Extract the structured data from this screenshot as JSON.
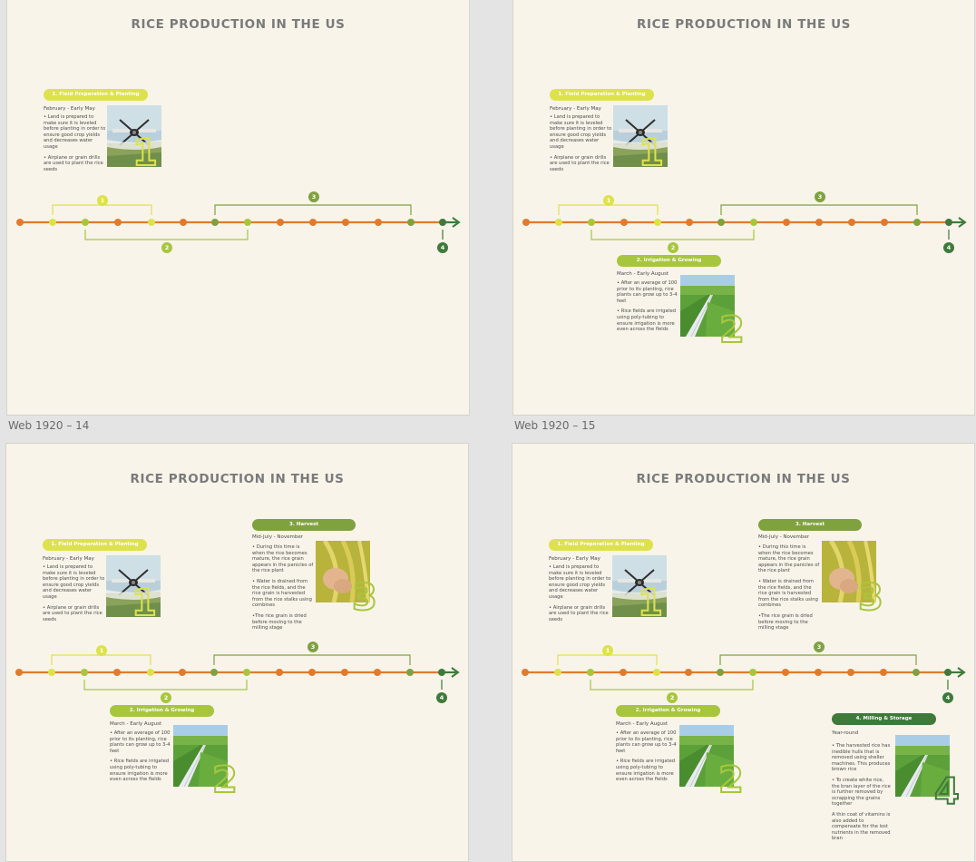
{
  "colors": {
    "orange": "#e07b2e",
    "yellow": "#dde24c",
    "lime": "#a7c63d",
    "olive": "#7fa23f",
    "darkgreen": "#3f7a3a",
    "background": "#f8f4ea"
  },
  "title": "RICE PRODUCTION IN THE US",
  "frame_labels": {
    "f14": "Web 1920 – 14",
    "f15": "Web 1920 – 15"
  },
  "markers": {
    "m1": "1",
    "m2": "2",
    "m3": "3",
    "m4": "4"
  },
  "steps": {
    "s1": {
      "label": "1. Field Preparation & Planting",
      "date": "February - Early May",
      "b1": "• Land is prepared to make sure it is leveled before planting in order to ensure good crop yields and decreases water usage",
      "b2": "• Airplane or grain drills are used to plant the rice seeds",
      "num": "1",
      "image_icon": "crop-duster-airplane-image"
    },
    "s2": {
      "label": "2. Irrigation & Growing",
      "date": "March - Early August",
      "b1": "• After an average of 100 prior to its planting, rice plants can grow up to 3-4 feet",
      "b2": "• Rice fields are irrigated using poly-tubing to ensure irrigation is more even across the fields",
      "num": "2",
      "image_icon": "irrigated-rice-field-image"
    },
    "s3": {
      "label": "3. Harvest",
      "date": "Mid-July - November",
      "b1": "• During this time is when the rice becomes mature, the rice grain appears in the panicles of the rice plant",
      "b2": "• Water is drained from the rice fields, and the rice grain is harvested from the rice stalks using combines",
      "b3": "•The rice grain is dried before moving to the milling stage",
      "num": "3",
      "image_icon": "rice-grain-hand-image"
    },
    "s4": {
      "label": "4. Milling & Storage",
      "date": "Year-round",
      "b1": "• The harvested rice has inedible hulls that is removed using sheller machines. This produces brown rice",
      "b2": "• To create white rice, the bran layer of the rice is further removed by scrapping the grains together",
      "b3": "A thin coat of vitamins is also added to compensate for the lost nutrients in the removed bran",
      "num": "4",
      "image_icon": "irrigated-rice-field-image"
    }
  }
}
